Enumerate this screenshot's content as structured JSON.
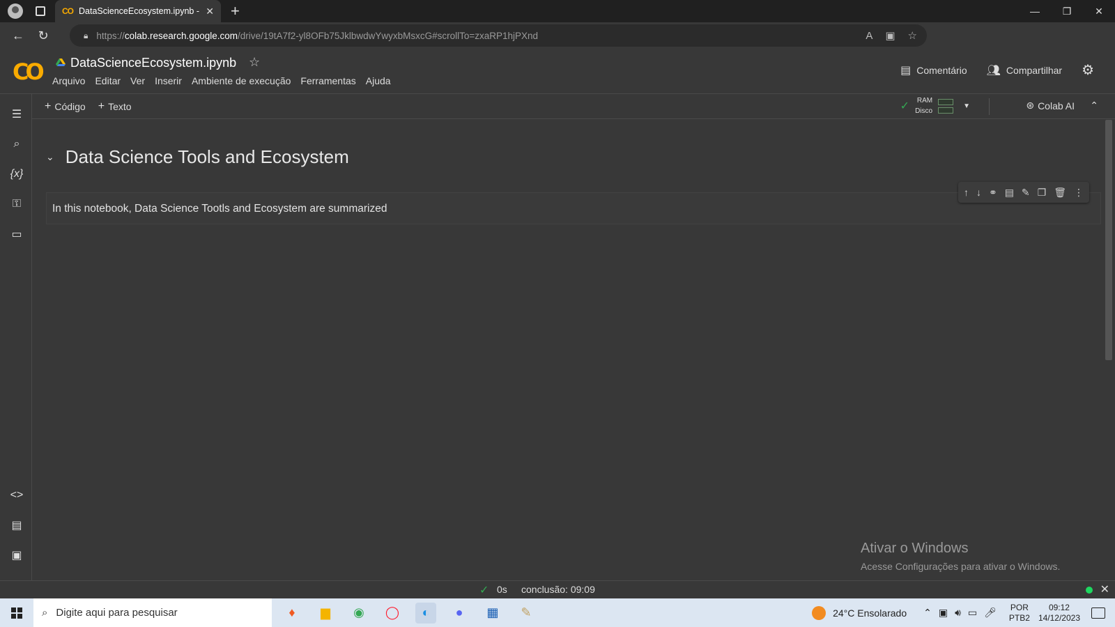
{
  "browser": {
    "tab_title": "DataScienceEcosystem.ipynb - Colab",
    "url_scheme": "https://",
    "url_host": "colab.research.google.com",
    "url_path": "/drive/19tA7f2-yl8OFb75JklbwdwYwyxbMsxcG#scrollTo=zxaRP1hjPXnd"
  },
  "colab": {
    "notebook_title": "DataScienceEcosystem.ipynb",
    "menu": [
      "Arquivo",
      "Editar",
      "Ver",
      "Inserir",
      "Ambiente de execução",
      "Ferramentas",
      "Ajuda"
    ],
    "comment_label": "Comentário",
    "share_label": "Compartilhar",
    "add_code_label": "Código",
    "add_text_label": "Texto",
    "ram_label": "RAM",
    "disk_label": "Disco",
    "colab_ai_label": "Colab AI",
    "heading": "Data Science Tools and Ecosystem",
    "cell_text": "In this notebook, Data Science Tootls and Ecosystem are summarized",
    "status_time": "0s",
    "status_conclusion": "conclusão: 09:09"
  },
  "watermark": {
    "title": "Ativar o Windows",
    "subtitle": "Acesse Configurações para ativar o Windows."
  },
  "taskbar": {
    "search_placeholder": "Digite aqui para pesquisar",
    "weather": "24°C  Ensolarado",
    "lang_top": "POR",
    "lang_bottom": "PTB2",
    "time": "09:12",
    "date": "14/12/2023"
  }
}
